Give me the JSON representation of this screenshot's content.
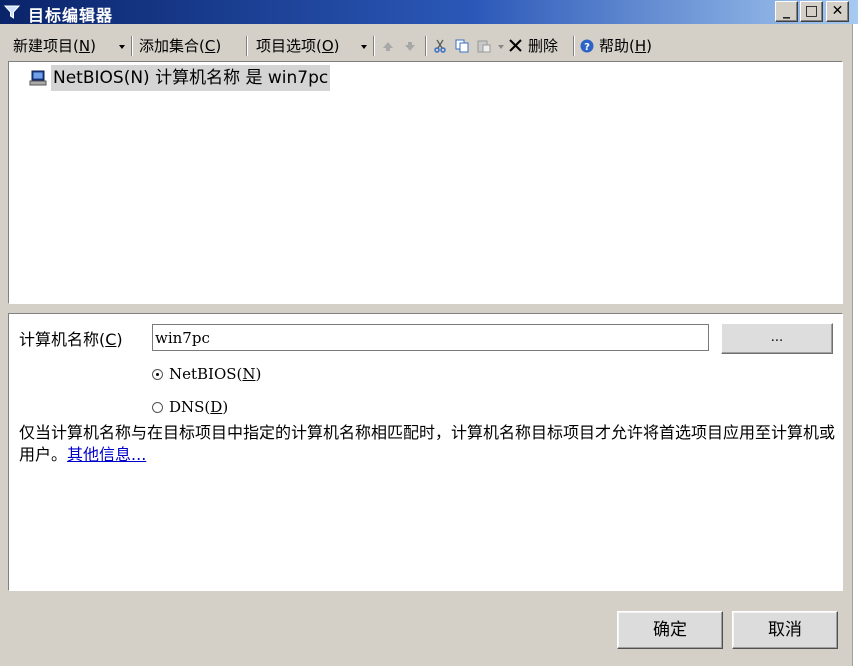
{
  "window": {
    "title": "目标编辑器",
    "controls": {
      "minimize": "_",
      "maximize": "□",
      "close": "✕"
    }
  },
  "toolbar": {
    "new_item_text": "新建项目(",
    "new_item_key": "N",
    "new_item_tail": ")",
    "add_collection_text": "添加集合(",
    "add_collection_key": "C",
    "add_collection_tail": ")",
    "item_options_text": "项目选项(",
    "item_options_key": "O",
    "item_options_tail": ")",
    "delete_label": "删除",
    "help_text": "帮助(",
    "help_key": "H",
    "help_tail": ")"
  },
  "tree": {
    "items": [
      {
        "label": "NetBIOS(N) 计算机名称 是 win7pc",
        "icon": "computer-icon"
      }
    ]
  },
  "form": {
    "computer_name_text": "计算机名称(",
    "computer_name_key": "C",
    "computer_name_tail": ")",
    "computer_name_value": "win7pc",
    "browse_label": "...",
    "radio_netbios_text": "NetBIOS(",
    "radio_netbios_key": "N",
    "radio_netbios_tail": ")",
    "radio_netbios_selected": true,
    "radio_dns_text": "DNS(",
    "radio_dns_key": "D",
    "radio_dns_tail": ")",
    "radio_dns_selected": false,
    "description": "仅当计算机名称与在目标项目中指定的计算机名称相匹配时，计算机名称目标项目才允许将首选项目应用至计算机或用户。",
    "more_info_link": "其他信息..."
  },
  "buttons": {
    "ok": "确定",
    "cancel": "取消"
  },
  "colors": {
    "title_gradient_start": "#0a246a",
    "title_gradient_end": "#a6caf0",
    "dialog_bg": "#d4d0c8",
    "link": "#0000cc"
  }
}
